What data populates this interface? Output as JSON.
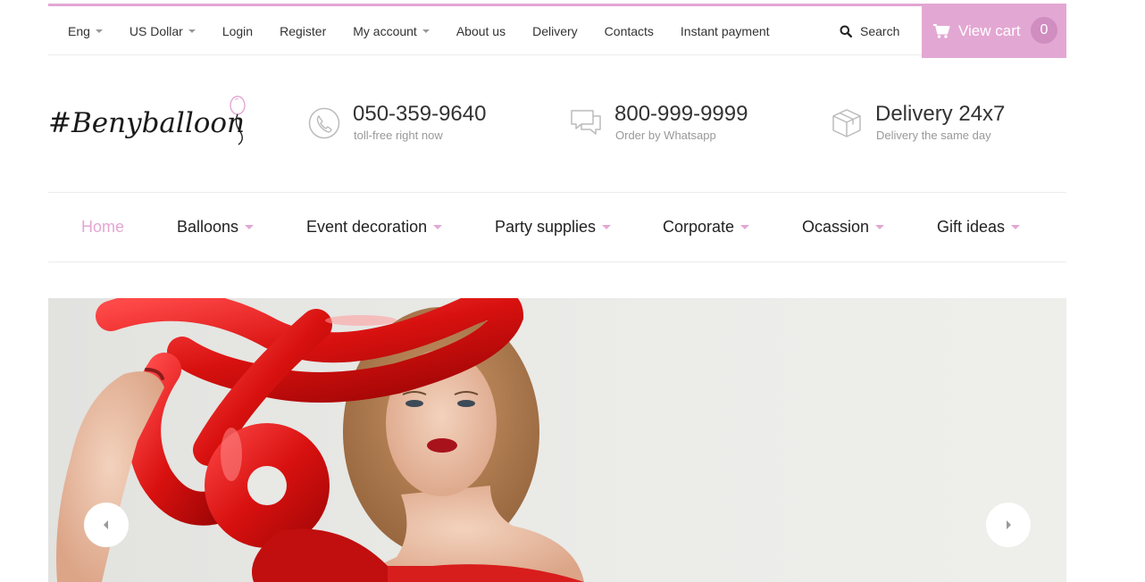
{
  "topbar": {
    "items": [
      {
        "label": "Eng",
        "dropdown": true
      },
      {
        "label": "US Dollar",
        "dropdown": true
      },
      {
        "label": "Login",
        "dropdown": false
      },
      {
        "label": "Register",
        "dropdown": false
      },
      {
        "label": "My account",
        "dropdown": true
      },
      {
        "label": "About us",
        "dropdown": false
      },
      {
        "label": "Delivery",
        "dropdown": false
      },
      {
        "label": "Contacts",
        "dropdown": false
      },
      {
        "label": "Instant payment",
        "dropdown": false
      }
    ],
    "search_label": "Search",
    "cart": {
      "label": "View cart",
      "count": "0"
    }
  },
  "brand": {
    "logo_text": "#Benyballoon",
    "icon": "balloon-icon"
  },
  "contacts": [
    {
      "icon": "phone-icon",
      "title": "050-359-9640",
      "subtitle": "toll-free right now"
    },
    {
      "icon": "chat-bubbles-icon",
      "title": "800-999-9999",
      "subtitle": "Order by Whatsapp"
    },
    {
      "icon": "box-icon",
      "title": "Delivery 24x7",
      "subtitle": "Delivery the same day"
    }
  ],
  "mainnav": {
    "items": [
      {
        "label": "Home",
        "active": true,
        "dropdown": false
      },
      {
        "label": "Balloons",
        "active": false,
        "dropdown": true
      },
      {
        "label": "Event decoration",
        "active": false,
        "dropdown": true
      },
      {
        "label": "Party supplies",
        "active": false,
        "dropdown": true
      },
      {
        "label": "Corporate",
        "active": false,
        "dropdown": true
      },
      {
        "label": "Ocassion",
        "active": false,
        "dropdown": true
      },
      {
        "label": "Gift ideas",
        "active": false,
        "dropdown": true
      }
    ]
  },
  "hero": {
    "prev_icon": "chevron-left-icon",
    "next_icon": "chevron-right-icon"
  },
  "colors": {
    "accent": "#e3a7d3",
    "cart_badge": "#d08dc0",
    "text": "#333333",
    "muted": "#999999",
    "hero_bg": "#e9e9e6",
    "balloon_red": "#e01b1b"
  }
}
